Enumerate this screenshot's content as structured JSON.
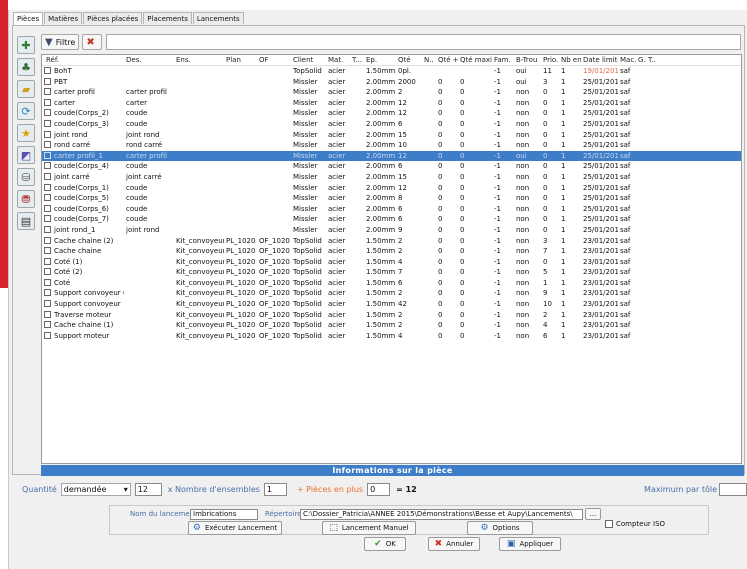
{
  "tabs": [
    "Pièces",
    "Matières",
    "Pièces placées",
    "Placements",
    "Lancements"
  ],
  "toolbar": {
    "filter_label": "Filtre"
  },
  "sidebar_icons": [
    "add-part-icon",
    "tree-icon",
    "open-folder-icon",
    "refresh-icon",
    "star-icon",
    "nesting-icon",
    "database-icon",
    "database-link-icon",
    "report-icon"
  ],
  "columns": [
    "Réf.",
    "Des.",
    "Ens.",
    "Plan",
    "OF",
    "Client",
    "Mat.",
    "T...",
    "Ep.",
    "Qté",
    "N..",
    "Qté +",
    "Qté maxi",
    "Fam.",
    "B-Trou",
    "Prio.",
    "Nb ent.",
    "Date limite",
    "Mac.",
    "G..",
    "T.."
  ],
  "rows": [
    [
      "BohT",
      "",
      "",
      "",
      "",
      "TopSolid",
      "acier",
      "",
      "1.50mm",
      "0pl.",
      "",
      "",
      "",
      "-1",
      "oui",
      "11",
      "1",
      "19/01/2015",
      "saf"
    ],
    [
      "PBT",
      "",
      "",
      "",
      "",
      "Missler",
      "acier",
      "",
      "2.00mm",
      "2000",
      "",
      "0",
      "0",
      "-1",
      "oui",
      "3",
      "1",
      "25/01/2015",
      "saf"
    ],
    [
      "carter profil",
      "carter profil",
      "",
      "",
      "",
      "Missler",
      "acier",
      "",
      "2.00mm",
      "2",
      "",
      "0",
      "0",
      "-1",
      "non",
      "0",
      "1",
      "25/01/2015",
      "saf"
    ],
    [
      "carter",
      "carter",
      "",
      "",
      "",
      "Missler",
      "acier",
      "",
      "2.00mm",
      "12",
      "",
      "0",
      "0",
      "-1",
      "non",
      "0",
      "1",
      "25/01/2015",
      "saf"
    ],
    [
      "coude(Corps_2)",
      "coude",
      "",
      "",
      "",
      "Missler",
      "acier",
      "",
      "2.00mm",
      "12",
      "",
      "0",
      "0",
      "-1",
      "non",
      "0",
      "1",
      "25/01/2015",
      "saf"
    ],
    [
      "coude(Corps_3)",
      "coude",
      "",
      "",
      "",
      "Missler",
      "acier",
      "",
      "2.00mm",
      "6",
      "",
      "0",
      "0",
      "-1",
      "non",
      "0",
      "1",
      "25/01/2015",
      "saf"
    ],
    [
      "joint rond",
      "joint rond",
      "",
      "",
      "",
      "Missler",
      "acier",
      "",
      "2.00mm",
      "15",
      "",
      "0",
      "0",
      "-1",
      "non",
      "0",
      "1",
      "25/01/2015",
      "saf"
    ],
    [
      "rond carré",
      "rond carré",
      "",
      "",
      "",
      "Missler",
      "acier",
      "",
      "2.00mm",
      "10",
      "",
      "0",
      "0",
      "-1",
      "non",
      "0",
      "1",
      "25/01/2015",
      "saf"
    ],
    [
      "carter profil_1",
      "carter profil",
      "",
      "",
      "",
      "Missler",
      "acier",
      "",
      "2.00mm",
      "12",
      "",
      "0",
      "0",
      "-1",
      "oui",
      "0",
      "1",
      "25/01/2015",
      "saf"
    ],
    [
      "coude(Corps_4)",
      "coude",
      "",
      "",
      "",
      "Missler",
      "acier",
      "",
      "2.00mm",
      "6",
      "",
      "0",
      "0",
      "-1",
      "non",
      "0",
      "1",
      "25/01/2015",
      "saf"
    ],
    [
      "joint carré",
      "joint carré",
      "",
      "",
      "",
      "Missler",
      "acier",
      "",
      "2.00mm",
      "15",
      "",
      "0",
      "0",
      "-1",
      "non",
      "0",
      "1",
      "25/01/2015",
      "saf"
    ],
    [
      "coude(Corps_1)",
      "coude",
      "",
      "",
      "",
      "Missler",
      "acier",
      "",
      "2.00mm",
      "12",
      "",
      "0",
      "0",
      "-1",
      "non",
      "0",
      "1",
      "25/01/2015",
      "saf"
    ],
    [
      "coude(Corps_5)",
      "coude",
      "",
      "",
      "",
      "Missler",
      "acier",
      "",
      "2.00mm",
      "8",
      "",
      "0",
      "0",
      "-1",
      "non",
      "0",
      "1",
      "25/01/2015",
      "saf"
    ],
    [
      "coude(Corps_6)",
      "coude",
      "",
      "",
      "",
      "Missler",
      "acier",
      "",
      "2.00mm",
      "6",
      "",
      "0",
      "0",
      "-1",
      "non",
      "0",
      "1",
      "25/01/2015",
      "saf"
    ],
    [
      "coude(Corps_7)",
      "coude",
      "",
      "",
      "",
      "Missler",
      "acier",
      "",
      "2.00mm",
      "6",
      "",
      "0",
      "0",
      "-1",
      "non",
      "0",
      "1",
      "25/01/2015",
      "saf"
    ],
    [
      "joint rond_1",
      "joint rond",
      "",
      "",
      "",
      "Missler",
      "acier",
      "",
      "2.00mm",
      "9",
      "",
      "0",
      "0",
      "-1",
      "non",
      "0",
      "1",
      "25/01/2015",
      "saf"
    ],
    [
      "Cache chaine (2)",
      "",
      "Kit_convoyeur",
      "PL_1020",
      "OF_1020",
      "TopSolid",
      "acier",
      "",
      "1.50mm",
      "2",
      "",
      "0",
      "0",
      "-1",
      "non",
      "3",
      "1",
      "23/01/2015",
      "saf"
    ],
    [
      "Cache chaine",
      "",
      "Kit_convoyeur",
      "PL_1020",
      "OF_1020",
      "TopSolid",
      "acier",
      "",
      "1.50mm",
      "2",
      "",
      "0",
      "0",
      "-1",
      "non",
      "7",
      "1",
      "23/01/2015",
      "saf"
    ],
    [
      "Coté (1)",
      "",
      "Kit_convoyeur",
      "PL_1020",
      "OF_1020",
      "TopSolid",
      "acier",
      "",
      "1.50mm",
      "4",
      "",
      "0",
      "0",
      "-1",
      "non",
      "0",
      "1",
      "23/01/2015",
      "saf"
    ],
    [
      "Coté (2)",
      "",
      "Kit_convoyeur",
      "PL_1020",
      "OF_1020",
      "TopSolid",
      "acier",
      "",
      "1.50mm",
      "7",
      "",
      "0",
      "0",
      "-1",
      "non",
      "5",
      "1",
      "23/01/2015",
      "saf"
    ],
    [
      "Coté",
      "",
      "Kit_convoyeur",
      "PL_1020",
      "OF_1020",
      "TopSolid",
      "acier",
      "",
      "1.50mm",
      "6",
      "",
      "0",
      "0",
      "-1",
      "non",
      "1",
      "1",
      "23/01/2015",
      "saf"
    ],
    [
      "Support convoyeur (1)",
      "",
      "Kit_convoyeur",
      "PL_1020",
      "OF_1020",
      "TopSolid",
      "acier",
      "",
      "1.50mm",
      "2",
      "",
      "0",
      "0",
      "-1",
      "non",
      "9",
      "1",
      "23/01/2015",
      "saf"
    ],
    [
      "Support convoyeur",
      "",
      "Kit_convoyeur",
      "PL_1020",
      "OF_1020",
      "TopSolid",
      "acier",
      "",
      "1.50mm",
      "42",
      "",
      "0",
      "0",
      "-1",
      "non",
      "10",
      "1",
      "23/01/2015",
      "saf"
    ],
    [
      "Traverse moteur",
      "",
      "Kit_convoyeur",
      "PL_1020",
      "OF_1020",
      "TopSolid",
      "acier",
      "",
      "1.50mm",
      "2",
      "",
      "0",
      "0",
      "-1",
      "non",
      "2",
      "1",
      "23/01/2015",
      "saf"
    ],
    [
      "Cache chaine (1)",
      "",
      "Kit_convoyeur",
      "PL_1020",
      "OF_1020",
      "TopSolid",
      "acier",
      "",
      "1.50mm",
      "2",
      "",
      "0",
      "0",
      "-1",
      "non",
      "4",
      "1",
      "23/01/2015",
      "saf"
    ],
    [
      "Support moteur",
      "",
      "Kit_convoyeur",
      "PL_1020",
      "OF_1020",
      "TopSolid",
      "acier",
      "",
      "1.50mm",
      "4",
      "",
      "0",
      "0",
      "-1",
      "non",
      "6",
      "1",
      "23/01/2015",
      "saf"
    ]
  ],
  "selected_row": 8,
  "overdue_row": 0,
  "info": {
    "title": "Informations sur la pièce",
    "quantity_label": "Quantité",
    "quantity_mode": "demandée",
    "quantity_value": "12",
    "nb_sets_label": "x Nombre d'ensembles",
    "nb_sets_value": "1",
    "extra_label": "+ Pièces en plus",
    "extra_value": "0",
    "total": "= 12",
    "max_label": "Maximum par tôle",
    "max_value": ""
  },
  "launch": {
    "name_label": "Nom du lancement",
    "name_value": "Imbrications",
    "dir_label": "Répertoire",
    "dir_value": "C:\\Dossier_Patricia\\ANNEE 2015\\Démonstrations\\Besse et Aupy\\Lancements\\",
    "browse_label": "...",
    "iso_label": "Compteur ISO",
    "exec_label": "Exécuter Lancement",
    "manual_label": "Lancement Manuel",
    "options_label": "Options"
  },
  "actions": {
    "ok": "OK",
    "cancel": "Annuler",
    "apply": "Appliquer"
  },
  "colors": {
    "accent": "#3e7ec8",
    "brand_red": "#d9232d",
    "overdue": "#e06a4a",
    "label_blue": "#4a6fa8",
    "orange": "#e8712e"
  }
}
